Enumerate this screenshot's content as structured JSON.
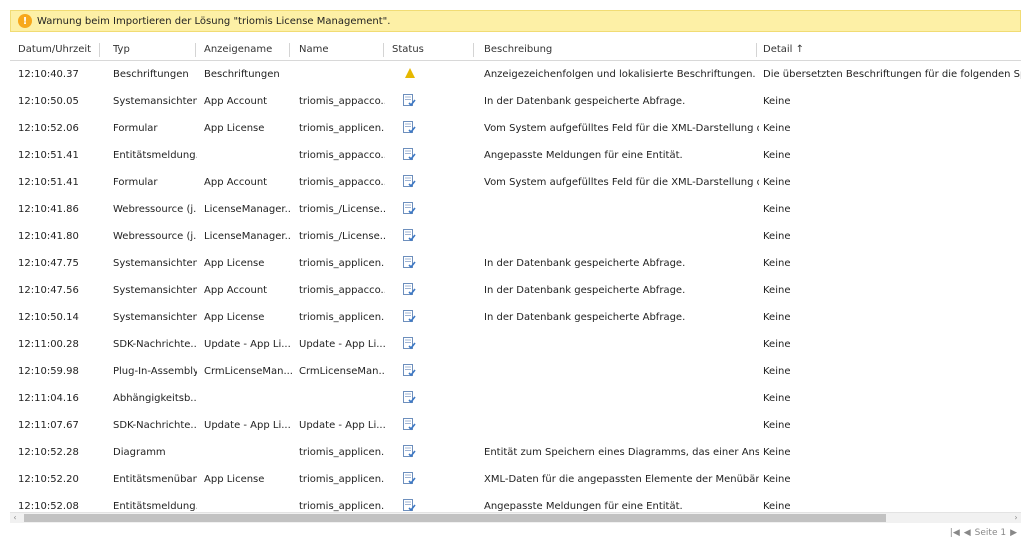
{
  "warning": {
    "message": "Warnung beim Importieren der Lösung \"triomis License Management\"."
  },
  "columns": [
    {
      "label": "Datum/Uhrzeit"
    },
    {
      "label": "Typ"
    },
    {
      "label": "Anzeigename"
    },
    {
      "label": "Name"
    },
    {
      "label": "Status"
    },
    {
      "label": "Beschreibung"
    },
    {
      "label": "Detail ↑"
    }
  ],
  "rows": [
    {
      "time": "12:10:40.37",
      "type": "Beschriftungen",
      "display": "Beschriftungen",
      "name": "",
      "status": "warning-icon",
      "desc": "Anzeigezeichenfolgen und lokalisierte Beschriftungen.",
      "detail": "Die übersetzten Beschriftungen für die folgenden Sprache"
    },
    {
      "time": "12:10:50.05",
      "type": "Systemansichten",
      "display": "App Account",
      "name": "triomis_appacco...",
      "status": "document-check-icon",
      "desc": "In der Datenbank gespeicherte Abfrage.",
      "detail": "Keine"
    },
    {
      "time": "12:10:52.06",
      "type": "Formular",
      "display": "App License",
      "name": "triomis_applicen...",
      "status": "document-check-icon",
      "desc": "Vom System aufgefülltes Feld für die XML-Darstellung de...",
      "detail": "Keine"
    },
    {
      "time": "12:10:51.41",
      "type": "Entitätsmeldung...",
      "display": "",
      "name": "triomis_appacco...",
      "status": "document-check-icon",
      "desc": "Angepasste Meldungen für eine Entität.",
      "detail": "Keine"
    },
    {
      "time": "12:10:51.41",
      "type": "Formular",
      "display": "App Account",
      "name": "triomis_appacco...",
      "status": "document-check-icon",
      "desc": "Vom System aufgefülltes Feld für die XML-Darstellung de...",
      "detail": "Keine"
    },
    {
      "time": "12:10:41.86",
      "type": "Webressource (j...",
      "display": "LicenseManager...",
      "name": "triomis_/License...",
      "status": "document-check-icon",
      "desc": "",
      "detail": "Keine"
    },
    {
      "time": "12:10:41.80",
      "type": "Webressource (j...",
      "display": "LicenseManager...",
      "name": "triomis_/License...",
      "status": "document-check-icon",
      "desc": "",
      "detail": "Keine"
    },
    {
      "time": "12:10:47.75",
      "type": "Systemansichten",
      "display": "App License",
      "name": "triomis_applicen...",
      "status": "document-check-icon",
      "desc": "In der Datenbank gespeicherte Abfrage.",
      "detail": "Keine"
    },
    {
      "time": "12:10:47.56",
      "type": "Systemansichten",
      "display": "App Account",
      "name": "triomis_appacco...",
      "status": "document-check-icon",
      "desc": "In der Datenbank gespeicherte Abfrage.",
      "detail": "Keine"
    },
    {
      "time": "12:10:50.14",
      "type": "Systemansichten",
      "display": "App License",
      "name": "triomis_applicen...",
      "status": "document-check-icon",
      "desc": "In der Datenbank gespeicherte Abfrage.",
      "detail": "Keine"
    },
    {
      "time": "12:11:00.28",
      "type": "SDK-Nachrichte...",
      "display": "Update - App Li...",
      "name": "Update - App Li...",
      "status": "document-check-icon",
      "desc": "",
      "detail": "Keine"
    },
    {
      "time": "12:10:59.98",
      "type": "Plug-In-Assembly",
      "display": "CrmLicenseMan...",
      "name": "CrmLicenseMan...",
      "status": "document-check-icon",
      "desc": "",
      "detail": "Keine"
    },
    {
      "time": "12:11:04.16",
      "type": "Abhängigkeitsb...",
      "display": "",
      "name": "",
      "status": "document-check-icon",
      "desc": "",
      "detail": "Keine"
    },
    {
      "time": "12:11:07.67",
      "type": "SDK-Nachrichte...",
      "display": "Update - App Li...",
      "name": "Update - App Li...",
      "status": "document-check-icon",
      "desc": "",
      "detail": "Keine"
    },
    {
      "time": "12:10:52.28",
      "type": "Diagramm",
      "display": "",
      "name": "triomis_applicen...",
      "status": "document-check-icon",
      "desc": "Entität zum Speichern eines Diagramms, das einer Ansicht...",
      "detail": "Keine"
    },
    {
      "time": "12:10:52.20",
      "type": "Entitätsmenüband",
      "display": "App License",
      "name": "triomis_applicen...",
      "status": "document-check-icon",
      "desc": "XML-Daten für die angepassten Elemente der Menübänd...",
      "detail": "Keine"
    },
    {
      "time": "12:10:52.08",
      "type": "Entitätsmeldung...",
      "display": "",
      "name": "triomis_applicen...",
      "status": "document-check-icon",
      "desc": "Angepasste Meldungen für eine Entität.",
      "detail": "Keine"
    }
  ],
  "pager": {
    "first_icon": "first-page-icon",
    "prev_icon": "previous-page-icon",
    "label": "Seite 1",
    "next_icon": "next-page-icon"
  },
  "colors": {
    "warning_bg": "#fdf0a6",
    "warning_icon": "#f7a81b"
  }
}
